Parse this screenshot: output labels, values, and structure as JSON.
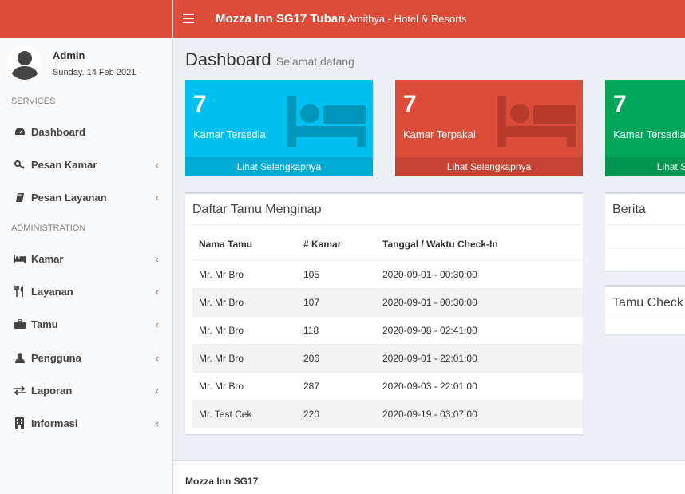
{
  "header": {
    "brand_bold": "Mozza Inn SG17 Tuban",
    "brand_sub": "Amithya - Hotel & Resorts"
  },
  "user": {
    "name": "Admin",
    "date": "Sunday. 14 Feb 2021"
  },
  "sidebar": {
    "services_header": "SERVICES",
    "admin_header": "ADMINISTRATION",
    "items": [
      {
        "label": "Dashboard",
        "icon": "dashboard-icon"
      },
      {
        "label": "Pesan Kamar",
        "icon": "key-icon"
      },
      {
        "label": "Pesan Layanan",
        "icon": "book-icon"
      },
      {
        "label": "Kamar",
        "icon": "bed-icon"
      },
      {
        "label": "Layanan",
        "icon": "cutlery-icon"
      },
      {
        "label": "Tamu",
        "icon": "briefcase-icon"
      },
      {
        "label": "Pengguna",
        "icon": "user-icon"
      },
      {
        "label": "Laporan",
        "icon": "exchange-icon"
      },
      {
        "label": "Informasi",
        "icon": "building-icon"
      }
    ]
  },
  "page": {
    "title": "Dashboard",
    "subtitle": "Selamat datang"
  },
  "stats": [
    {
      "value": "7",
      "label": "Kamar Tersedia",
      "link": "Lihat Selengkapnya",
      "color": "#00c0ef",
      "footer_color": "#00acd6",
      "icon_color": "#0096bb"
    },
    {
      "value": "7",
      "label": "Kamar Terpakai",
      "link": "Lihat Selengkapnya",
      "color": "#dd4b39",
      "footer_color": "#c64333",
      "icon_color": "#b63b2b"
    },
    {
      "value": "7",
      "label": "Kamar Tersedia",
      "link": "Lihat Selengkapnya",
      "color": "#00a65a",
      "footer_color": "#009551",
      "icon_color": "#008d4c"
    }
  ],
  "guests_box": {
    "title": "Daftar Tamu Menginap",
    "columns": [
      "Nama Tamu",
      "# Kamar",
      "Tanggal / Waktu Check-In"
    ],
    "rows": [
      [
        "Mr. Mr Bro",
        "105",
        "2020-09-01 - 00:30:00"
      ],
      [
        "Mr. Mr Bro",
        "107",
        "2020-09-01 - 00:30:00"
      ],
      [
        "Mr. Mr Bro",
        "118",
        "2020-09-08 - 02:41:00"
      ],
      [
        "Mr. Mr Bro",
        "206",
        "2020-09-01 - 22:01:00"
      ],
      [
        "Mr. Mr Bro",
        "287",
        "2020-09-03 - 22:01:00"
      ],
      [
        "Mr. Test Cek",
        "220",
        "2020-09-19 - 03:07:00"
      ]
    ]
  },
  "news_box": {
    "title": "Berita"
  },
  "checkout_box": {
    "title": "Tamu Check"
  },
  "footer": {
    "text": "Mozza Inn SG17"
  }
}
